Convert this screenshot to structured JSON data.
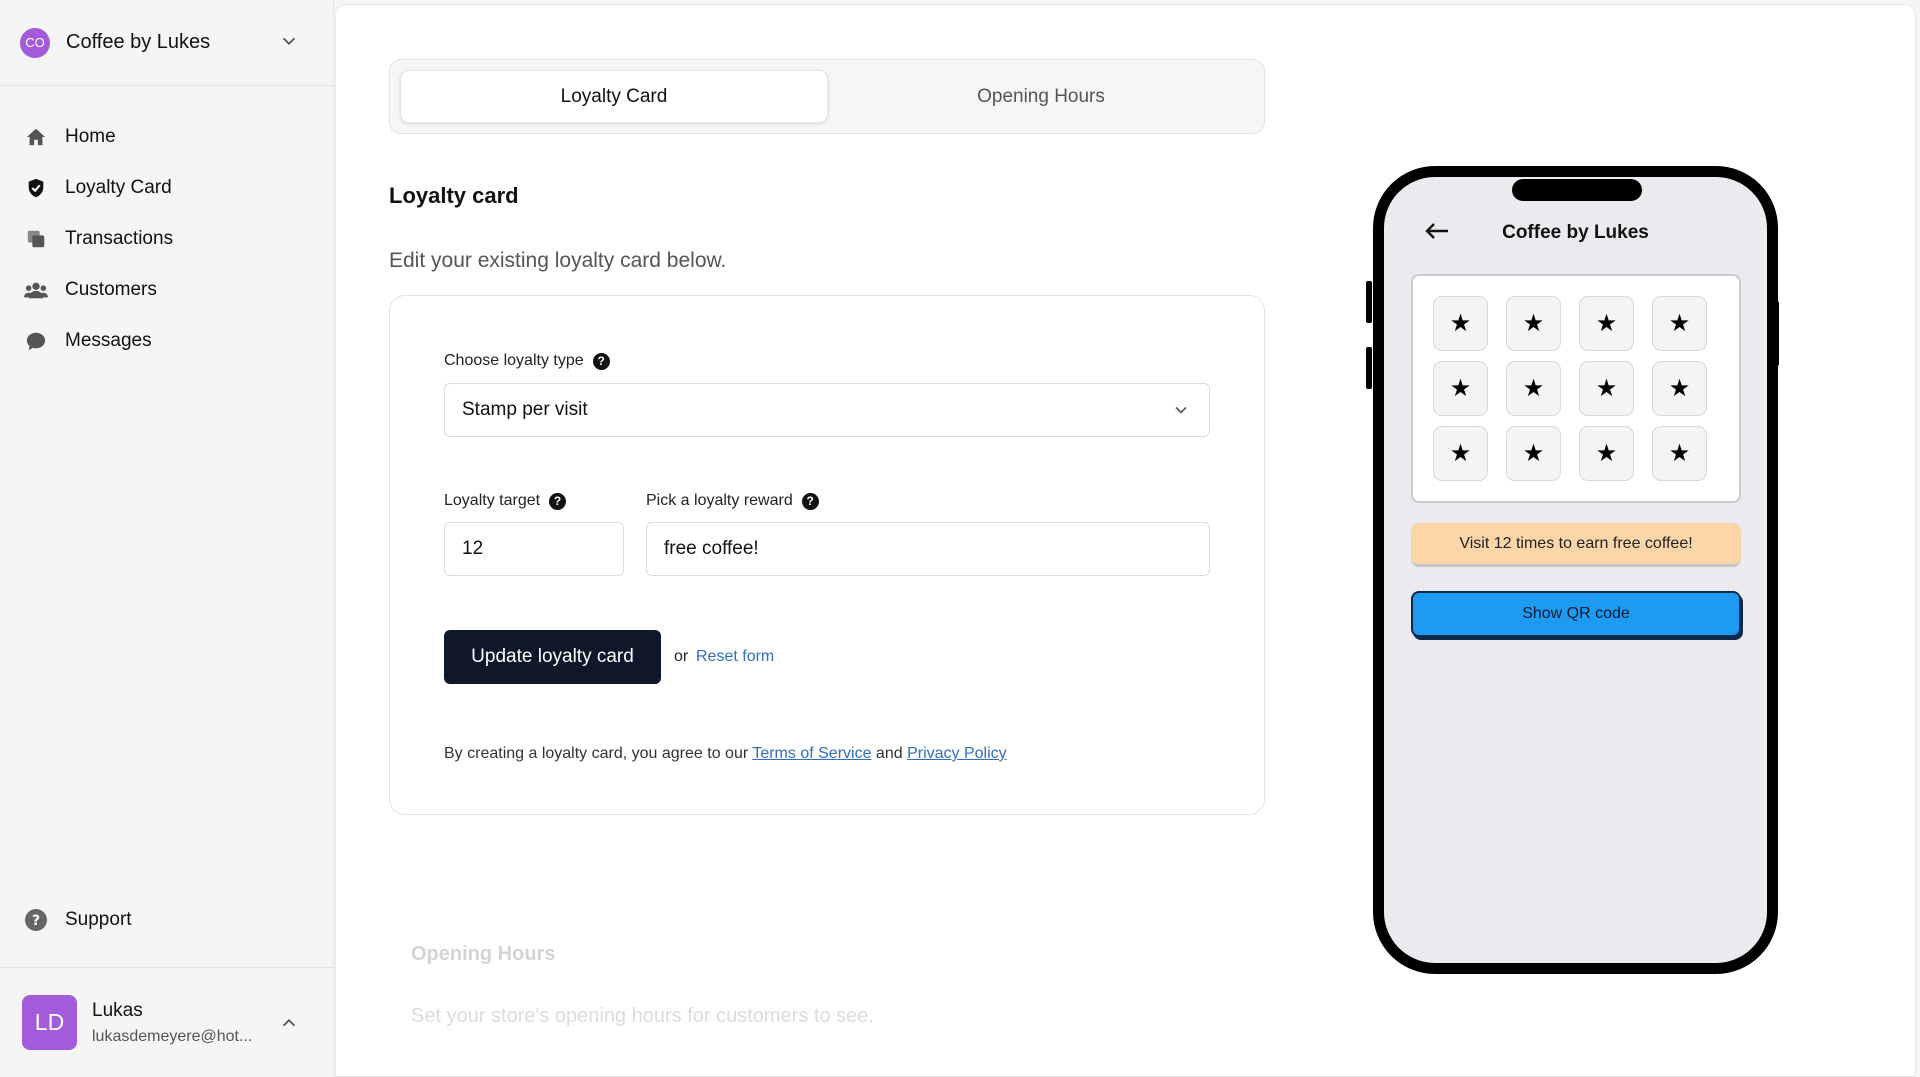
{
  "sidebar": {
    "org": {
      "initials": "CO",
      "name": "Coffee by Lukes"
    },
    "nav": [
      {
        "label": "Home",
        "icon": "home-icon"
      },
      {
        "label": "Loyalty Card",
        "icon": "shield-icon"
      },
      {
        "label": "Transactions",
        "icon": "copy-icon"
      },
      {
        "label": "Customers",
        "icon": "users-icon"
      },
      {
        "label": "Messages",
        "icon": "chat-icon"
      }
    ],
    "support": {
      "label": "Support",
      "icon": "question-icon"
    },
    "user": {
      "initials": "LD",
      "name": "Lukas",
      "email": "lukasdemeyere@hot..."
    }
  },
  "tabs": [
    {
      "label": "Loyalty Card",
      "active": true
    },
    {
      "label": "Opening Hours",
      "active": false
    }
  ],
  "loyalty": {
    "title": "Loyalty card",
    "description": "Edit your existing loyalty card below.",
    "type_label": "Choose loyalty type",
    "type_value": "Stamp per visit",
    "target_label": "Loyalty target",
    "target_value": "12",
    "reward_label": "Pick a loyalty reward",
    "reward_value": "free coffee!",
    "submit_label": "Update loyalty card",
    "or_text": "or",
    "reset_label": "Reset form",
    "terms_prefix": "By creating a loyalty card, you agree to our",
    "terms_link": "Terms of Service",
    "terms_and": "and",
    "privacy_link": "Privacy Policy"
  },
  "opening_hours": {
    "title": "Opening Hours",
    "description": "Set your store's opening hours for customers to see."
  },
  "phone_preview": {
    "title": "Coffee by Lukes",
    "stamp_count": 12,
    "stamp_icon": "star-icon",
    "reward_text": "Visit 12 times to earn free coffee!",
    "qr_button": "Show QR code"
  },
  "colors": {
    "accent_purple": "#a35bdc",
    "primary_button": "#0f172a",
    "link": "#2f6fbf",
    "reward_banner": "#fcd5a8",
    "qr_button": "#1c9bf0"
  }
}
